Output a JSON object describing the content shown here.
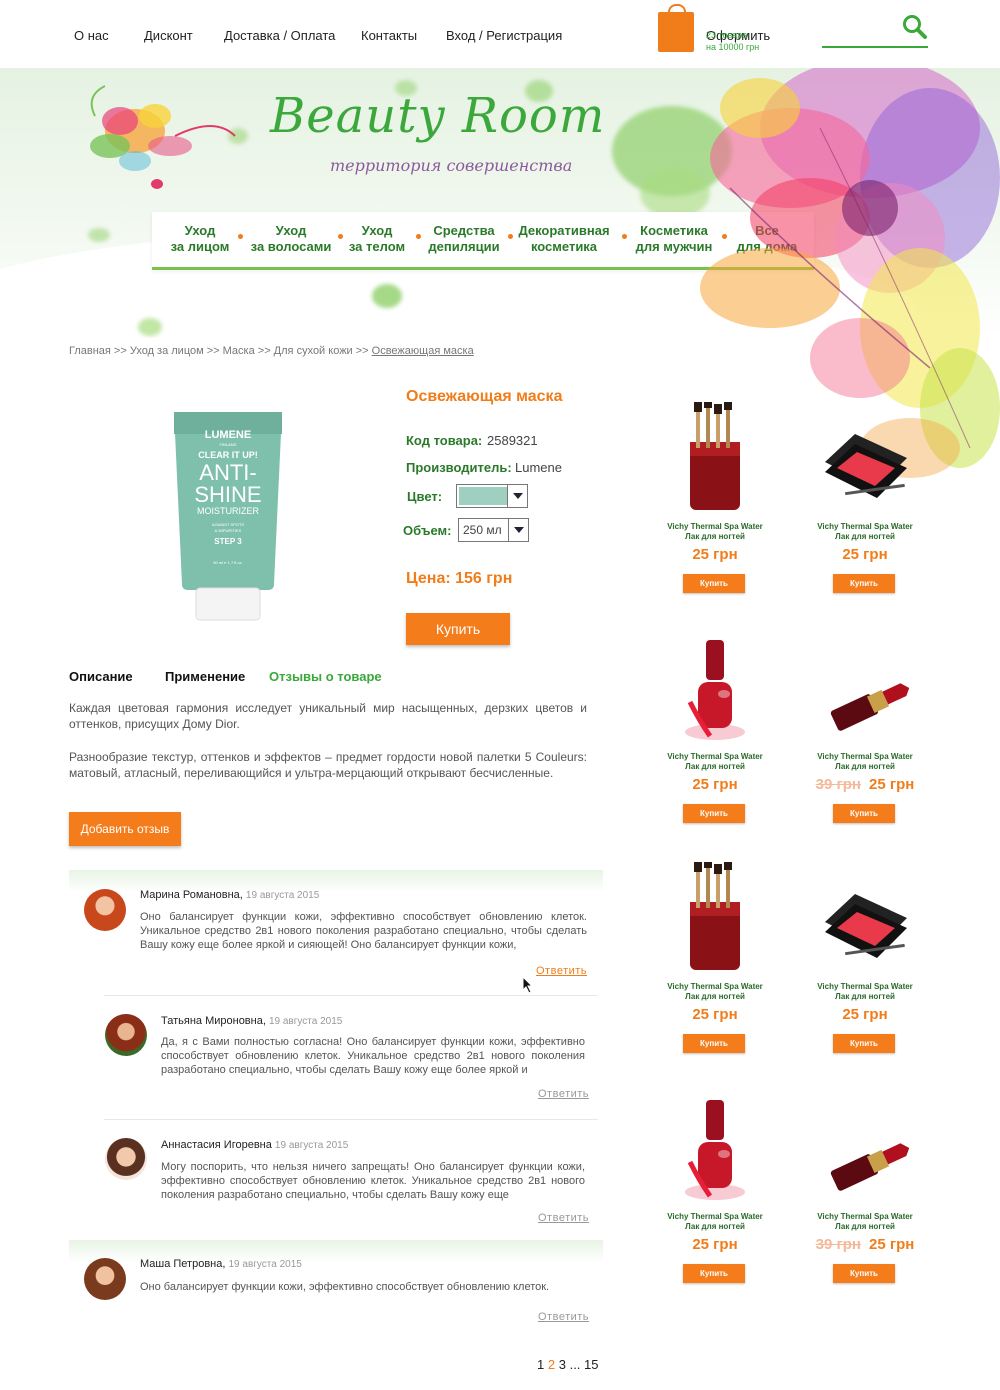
{
  "nav": {
    "about": "О нас",
    "discount": "Дисконт",
    "delivery": "Доставка / Оплата",
    "contacts": "Контакты",
    "login": "Вход / Регистрация"
  },
  "cart": {
    "checkout": "Оформить",
    "count": "23 товара",
    "sum": "на 10000 грн"
  },
  "brand": {
    "logo": "Beauty Room",
    "tagline": "территория совершенства"
  },
  "categories": [
    {
      "label": "Уход\nза лицом"
    },
    {
      "label": "Уход\nза волосами"
    },
    {
      "label": "Уход\nза телом"
    },
    {
      "label": "Средства\nдепиляции"
    },
    {
      "label": "Декоративная\nкосметика"
    },
    {
      "label": "Косметика\nдля мужчин"
    },
    {
      "label": "Все\nдля дома"
    }
  ],
  "breadcrumb": {
    "path": "Главная >> Уход за лицом >> Маска >> Для сухой кожи >> ",
    "current": "Освежающая маска"
  },
  "product": {
    "title": "Освежающая маска",
    "code_label": "Код товара:",
    "code": "2589321",
    "maker_label": "Производитель:",
    "maker": "Lumene",
    "color_label": "Цвет:",
    "color_value": "",
    "volume_label": "Объем:",
    "volume_value": "250 мл",
    "price": "Цена: 156 грн",
    "buy": "Купить",
    "tube": {
      "brand": "LUMENE",
      "origin": "FINLAND",
      "line": "CLEAR IT UP!",
      "name1": "ANTI-",
      "name2": "SHINE",
      "type": "MOISTURIZER",
      "note1": "AGAINST SPOTS",
      "note2": "& IMPURITIES",
      "step": "STEP 3",
      "volume": "50 ml ℮ 1.7 fl.oz."
    }
  },
  "tabs": {
    "description": "Описание",
    "usage": "Применение",
    "reviews": "Отзывы о товаре"
  },
  "description": {
    "p1": "Каждая цветовая гармония исследует уникальный мир насыщенных, дерзких цветов и оттенков, присущих Дому Dior.",
    "p2": "Разнообразие текстур, оттенков и эффектов – предмет гордости новой палетки 5 Couleurs: матовый, атласный, переливающийся и ультра-мерцающий открывают бесчисленные."
  },
  "add_review": "Добавить отзыв",
  "reviews": [
    {
      "name": "Марина Романовна,",
      "date": "19 августа 2015",
      "text": "Оно балансирует функции кожи, эффективно способствует обновлению клеток. Уникальное средство 2в1 нового поколения разработано специально, чтобы сделать Вашу кожу еще более яркой и сияющей! Оно балансирует функции кожи,",
      "reply": "Ответить"
    },
    {
      "name": "Татьяна Мироновна,",
      "date": "19 августа 2015",
      "text": "Да, я с Вами полностью согласна! Оно балансирует функции кожи, эффективно способствует обновлению клеток. Уникальное средство 2в1 нового поколения разработано специально, чтобы сделать Вашу кожу еще более яркой и",
      "reply": "Ответить"
    },
    {
      "name": "Аннастасия Игоревна",
      "date": "19 августа 2015",
      "text": "Могу поспорить, что нельзя ничего запрещать! Оно балансирует функции кожи, эффективно способствует обновлению клеток. Уникальное средство 2в1 нового поколения разработано специально, чтобы сделать Вашу кожу еще",
      "reply": "Ответить"
    },
    {
      "name": "Маша Петровна,",
      "date": "19 августа 2015",
      "text": "Оно балансирует функции кожи, эффективно способствует обновлению клеток.",
      "reply": "Ответить"
    }
  ],
  "pagination": {
    "p1": "1",
    "p2": "2",
    "p3": "3",
    "ellipsis": "...",
    "last": "15"
  },
  "sidebar": [
    {
      "name1": "Vichy Thermal Spa Water",
      "name2": "Лак для ногтей",
      "price": "25 грн",
      "old": "",
      "buy": "Купить",
      "kind": "brushes"
    },
    {
      "name1": "Vichy Thermal Spa Water",
      "name2": "Лак для ногтей",
      "price": "25 грн",
      "old": "",
      "buy": "Купить",
      "kind": "palette"
    },
    {
      "name1": "Vichy Thermal Spa Water",
      "name2": "Лак для ногтей",
      "price": "25 грн",
      "old": "",
      "buy": "Купить",
      "kind": "polish"
    },
    {
      "name1": "Vichy Thermal Spa Water",
      "name2": "Лак для ногтей",
      "price": "25 грн",
      "old": "39 грн",
      "buy": "Купить",
      "kind": "lipstick"
    },
    {
      "name1": "Vichy Thermal Spa Water",
      "name2": "Лак для ногтей",
      "price": "25 грн",
      "old": "",
      "buy": "Купить",
      "kind": "brushes"
    },
    {
      "name1": "Vichy Thermal Spa Water",
      "name2": "Лак для ногтей",
      "price": "25 грн",
      "old": "",
      "buy": "Купить",
      "kind": "palette"
    },
    {
      "name1": "Vichy Thermal Spa Water",
      "name2": "Лак для ногтей",
      "price": "25 грн",
      "old": "",
      "buy": "Купить",
      "kind": "polish"
    },
    {
      "name1": "Vichy Thermal Spa Water",
      "name2": "Лак для ногтей",
      "price": "25 грн",
      "old": "39 грн",
      "buy": "Купить",
      "kind": "lipstick"
    }
  ],
  "colors": {
    "accent_orange": "#f47c1a",
    "brand_green": "#3aa83a",
    "tube_teal": "#7fc0ad"
  }
}
